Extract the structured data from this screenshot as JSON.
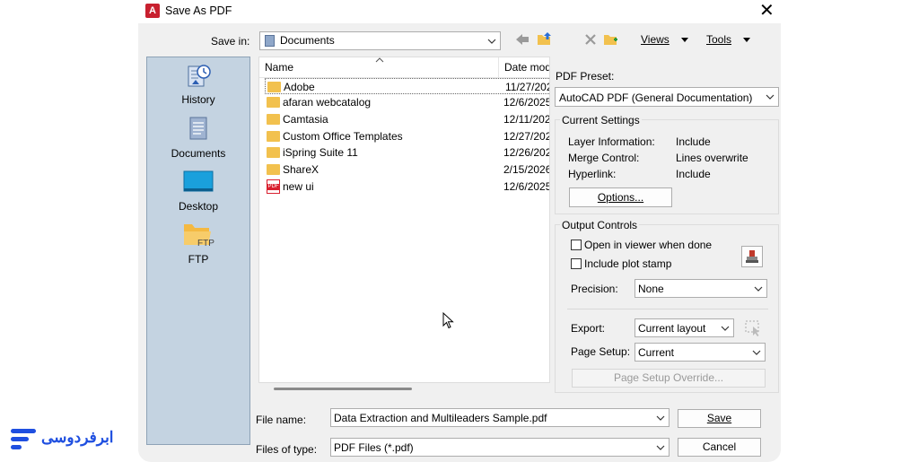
{
  "window": {
    "title": "Save As PDF",
    "close": "✕"
  },
  "save_in": {
    "label": "Save in:",
    "value": "Documents"
  },
  "toolbar": {
    "views": "Views",
    "tools": "Tools"
  },
  "places": [
    {
      "label": "History",
      "icon": "history-icon"
    },
    {
      "label": "Documents",
      "icon": "documents-icon"
    },
    {
      "label": "Desktop",
      "icon": "desktop-icon"
    },
    {
      "label": "FTP",
      "icon": "ftp-icon",
      "icon_text": "FTP"
    }
  ],
  "files": {
    "headers": {
      "name": "Name",
      "date": "Date mod"
    },
    "rows": [
      {
        "name": "Adobe",
        "date": "11/27/202",
        "icon": "folder-icon"
      },
      {
        "name": "afaran webcatalog",
        "date": "12/6/2025",
        "icon": "folder-icon"
      },
      {
        "name": "Camtasia",
        "date": "12/11/202",
        "icon": "folder-icon"
      },
      {
        "name": "Custom Office Templates",
        "date": "12/27/202",
        "icon": "folder-icon"
      },
      {
        "name": "iSpring Suite 11",
        "date": "12/26/202",
        "icon": "folder-icon"
      },
      {
        "name": "ShareX",
        "date": "2/15/2026",
        "icon": "folder-icon"
      },
      {
        "name": "new ui",
        "date": "12/6/2025",
        "icon": "pdf-icon",
        "icon_text": "PDF"
      }
    ]
  },
  "preset": {
    "label": "PDF Preset:",
    "value": "AutoCAD PDF (General Documentation)"
  },
  "current_settings": {
    "title": "Current Settings",
    "items": [
      {
        "key": "Layer Information:",
        "value": "Include"
      },
      {
        "key": "Merge Control:",
        "value": "Lines overwrite"
      },
      {
        "key": "Hyperlink:",
        "value": "Include"
      }
    ],
    "options_button": "Options..."
  },
  "output_controls": {
    "title": "Output Controls",
    "open_viewer": "Open in viewer when done",
    "plot_stamp": "Include plot stamp",
    "precision_label": "Precision:",
    "precision_value": "None",
    "export_label": "Export:",
    "export_value": "Current layout",
    "page_setup_label": "Page Setup:",
    "page_setup_value": "Current",
    "override_button": "Page Setup Override..."
  },
  "file_name": {
    "label": "File name:",
    "value": "Data Extraction and Multileaders Sample.pdf"
  },
  "file_type": {
    "label": "Files of type:",
    "value": "PDF Files (*.pdf)"
  },
  "buttons": {
    "save": "Save",
    "cancel": "Cancel"
  },
  "brand": {
    "text": "ابرفردوسی",
    "color": "#1f4fe0"
  },
  "colors": {
    "accent": "#1f4fe0",
    "folder": "#f2c14e",
    "pdf": "#d9202f"
  }
}
